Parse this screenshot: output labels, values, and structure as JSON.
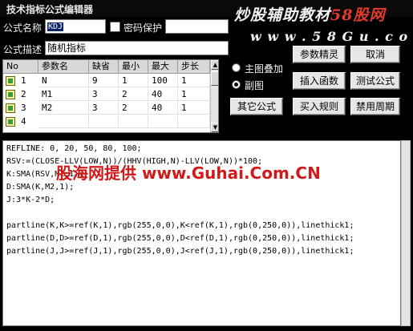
{
  "window": {
    "title": "技术指标公式编辑器"
  },
  "brand": {
    "main_prefix": "炒股辅助教材",
    "main_accent": "58股网",
    "url": "w w w . 5 8 G u . c o m"
  },
  "form": {
    "name_label": "公式名称",
    "name_value": "KDJ",
    "password_label": "密码保护",
    "desc_label": "公式描述",
    "desc_value": "随机指标"
  },
  "params_table": {
    "headers": [
      "No",
      "参数名",
      "缺省",
      "最小",
      "最大",
      "步长"
    ],
    "rows": [
      {
        "no": "1",
        "name": "N",
        "default": "9",
        "min": "1",
        "max": "100",
        "step": "1"
      },
      {
        "no": "2",
        "name": "M1",
        "default": "3",
        "min": "2",
        "max": "40",
        "step": "1"
      },
      {
        "no": "3",
        "name": "M2",
        "default": "3",
        "min": "2",
        "max": "40",
        "step": "1"
      },
      {
        "no": "4",
        "name": "",
        "default": "",
        "min": "",
        "max": "",
        "step": ""
      }
    ]
  },
  "options": {
    "main_overlay_label": "主图叠加",
    "sub_chart_label": "副图",
    "selected": "sub_chart"
  },
  "buttons": {
    "param_wizard": "参数精灵",
    "cancel": "取消",
    "insert_function": "插入函数",
    "test_formula": "测试公式",
    "other_formula": "其它公式",
    "buy_rules": "买入规则",
    "disabled_period": "禁用周期"
  },
  "editor": {
    "lines": [
      "REFLINE: 0, 20, 50, 80, 100;",
      "RSV:=(CLOSE-LLV(LOW,N))/(HHV(HIGH,N)-LLV(LOW,N))*100;",
      "K:SMA(RSV,M1,1);",
      "D:SMA(K,M2,1);",
      "J:3*K-2*D;",
      "",
      "partline(K,K>=ref(K,1),rgb(255,0,0),K<ref(K,1),rgb(0,250,0)),linethick1;",
      "partline(D,D>=ref(D,1),rgb(255,0,0),D<ref(D,1),rgb(0,250,0)),linethick1;",
      "partline(J,J>=ref(J,1),rgb(255,0,0),J<ref(J,1),rgb(0,250,0)),linethick1;"
    ],
    "watermark": "股海网提供 www.Guhai.Com.CN"
  },
  "colors": {
    "background": "#000000",
    "watermark": "#d01a1a",
    "brand_accent": "#e23b2e"
  }
}
